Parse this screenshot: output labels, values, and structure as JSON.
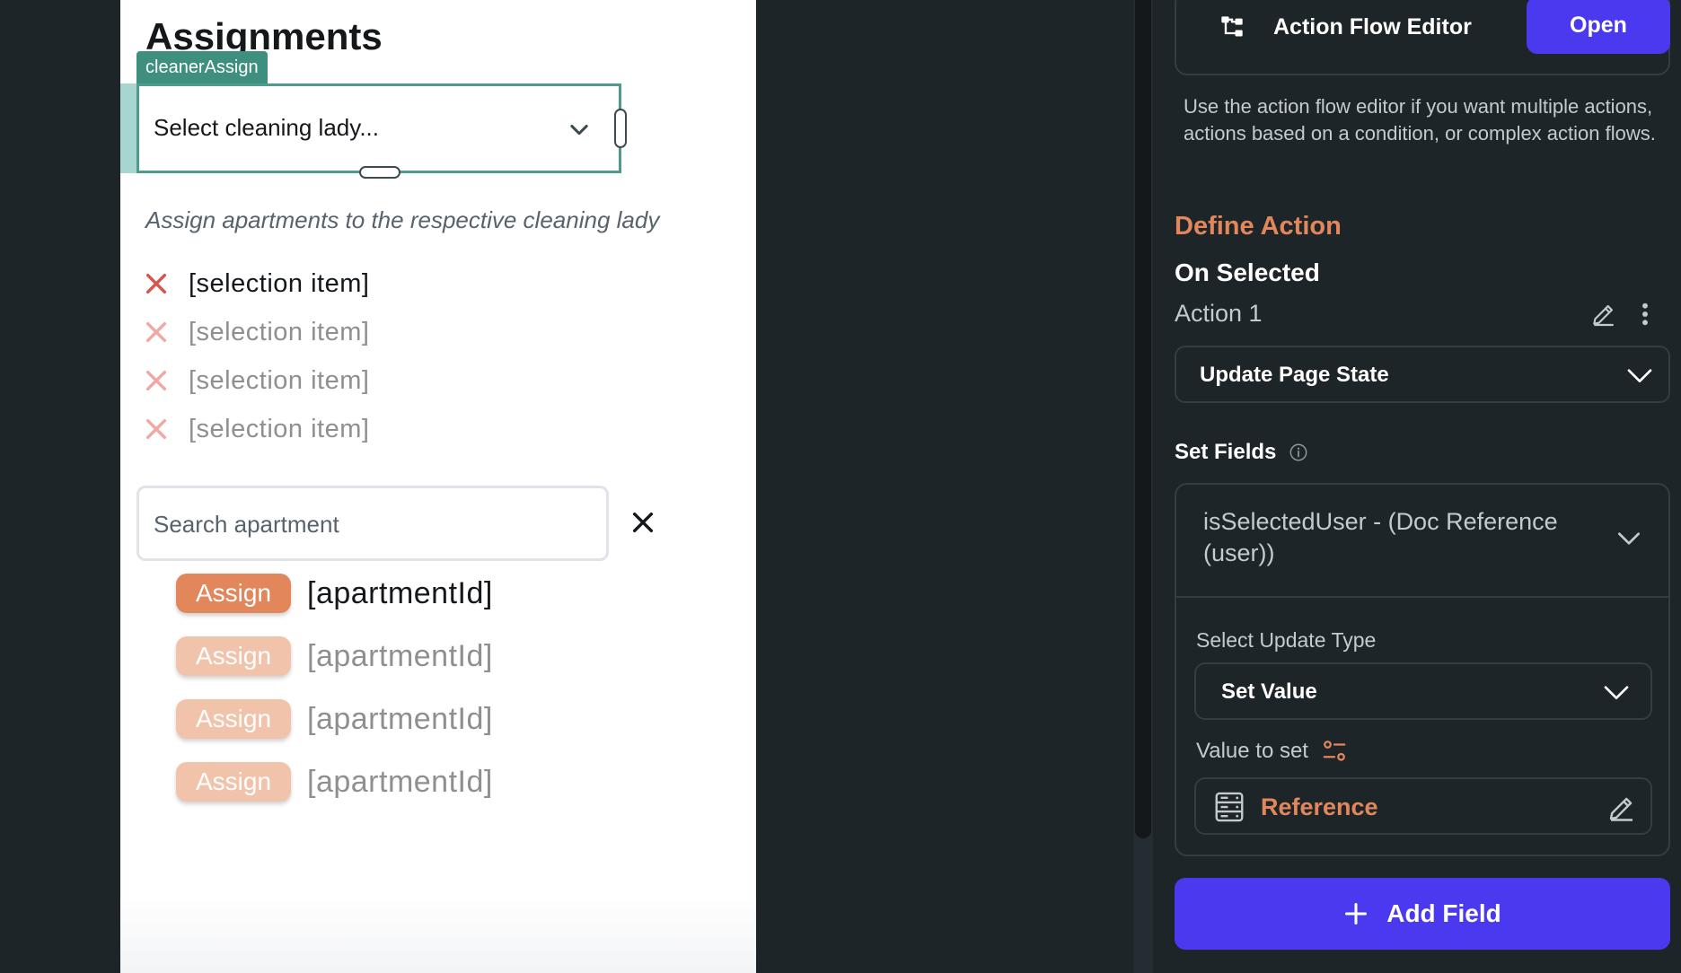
{
  "canvas": {
    "page_title": "Assignments",
    "widget_tag": "cleanerAssign",
    "dropdown_placeholder": "Select cleaning lady...",
    "hint": "Assign apartments to the respective cleaning lady",
    "selection_items": [
      {
        "label": "[selection item]"
      },
      {
        "label": "[selection item]"
      },
      {
        "label": "[selection item]"
      },
      {
        "label": "[selection item]"
      }
    ],
    "search_placeholder": "Search apartment",
    "apartments": [
      {
        "button": "Assign",
        "id": "[apartmentId]"
      },
      {
        "button": "Assign",
        "id": "[apartmentId]"
      },
      {
        "button": "Assign",
        "id": "[apartmentId]"
      },
      {
        "button": "Assign",
        "id": "[apartmentId]"
      }
    ]
  },
  "panel": {
    "action_flow_editor": {
      "title": "Action Flow Editor",
      "open_label": "Open",
      "description": "Use the action flow editor if you want multiple actions, actions based on a condition, or complex action flows."
    },
    "define_action": "Define Action",
    "trigger": "On Selected",
    "action_name": "Action 1",
    "action_type": "Update Page State",
    "set_fields_label": "Set Fields",
    "field": {
      "name": "isSelectedUser - (Doc Reference (user))",
      "update_type_label": "Select Update Type",
      "update_type": "Set Value",
      "value_label": "Value to set",
      "value": "Reference"
    },
    "add_field_label": "Add Field"
  },
  "colors": {
    "accent_orange": "#e2875c",
    "primary_blue": "#4b39ef",
    "selection_teal": "#4e9a8b",
    "error_red": "#d9534f",
    "panel_bg": "#1e2529"
  },
  "icons": [
    "chevron-down-icon",
    "close-icon",
    "flow-icon",
    "pencil-icon",
    "more-vertical-icon",
    "info-icon",
    "variable-icon",
    "database-icon",
    "plus-icon"
  ]
}
